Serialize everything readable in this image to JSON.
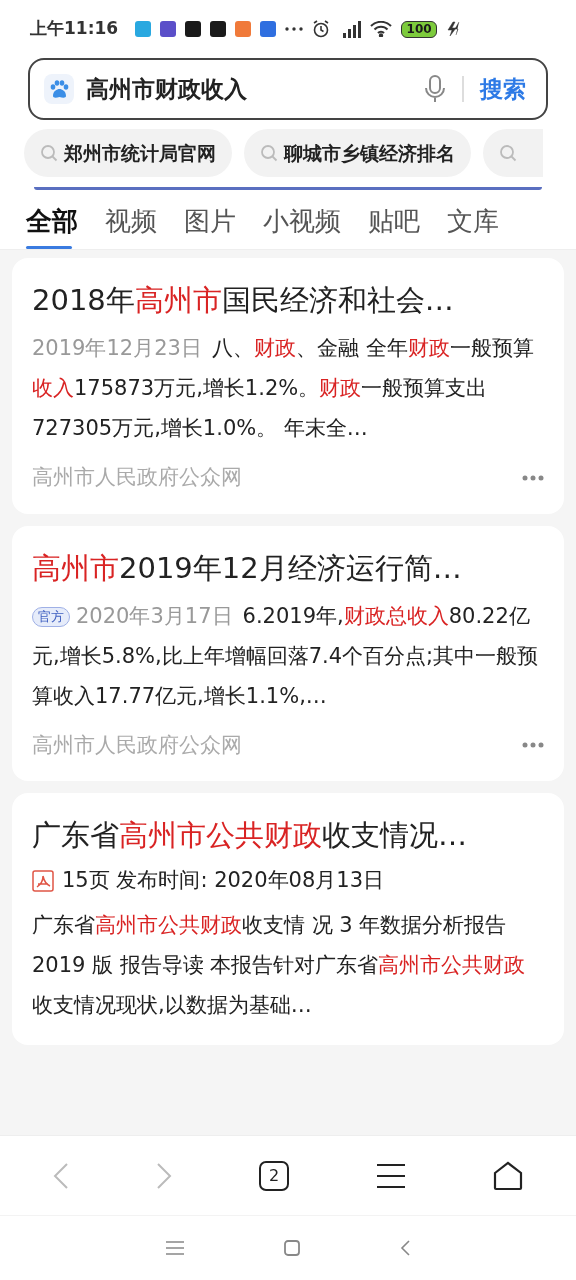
{
  "status_bar": {
    "time": "上午11:16",
    "battery": "100",
    "app_icons": [
      {
        "color": "#29a8e0"
      },
      {
        "color": "#5b4fc9"
      },
      {
        "color": "#1a1a1a"
      },
      {
        "color": "#1a1a1a"
      },
      {
        "color": "#f07a3a"
      },
      {
        "color": "#2f6fe0"
      }
    ]
  },
  "search": {
    "query": "高州市财政收入",
    "button": "搜索"
  },
  "suggestions": [
    "郑州市统计局官网",
    "聊城市乡镇经济排名"
  ],
  "tabs": [
    {
      "label": "全部",
      "selected": true
    },
    {
      "label": "视频",
      "selected": false
    },
    {
      "label": "图片",
      "selected": false
    },
    {
      "label": "小视频",
      "selected": false
    },
    {
      "label": "贴吧",
      "selected": false
    },
    {
      "label": "文库",
      "selected": false
    }
  ],
  "results": [
    {
      "kind": "web",
      "title": [
        {
          "text": "2018年",
          "highlight": false
        },
        {
          "text": "高州市",
          "highlight": true
        },
        {
          "text": "国民经济和社会…",
          "highlight": false
        }
      ],
      "meta": "2019年12月23日",
      "snippet": [
        {
          "text": "八、",
          "highlight": false
        },
        {
          "text": "财政",
          "highlight": true
        },
        {
          "text": "、金融 全年",
          "highlight": false
        },
        {
          "text": "财政",
          "highlight": true
        },
        {
          "text": "一般预算",
          "highlight": false
        },
        {
          "text": "收入",
          "highlight": true
        },
        {
          "text": "175873万元,增长1.2%。",
          "highlight": false
        },
        {
          "text": "财政",
          "highlight": true
        },
        {
          "text": "一般预算支出727305万元,增长1.0%。 年末全…",
          "highlight": false
        }
      ],
      "source": "高州市人民政府公众网"
    },
    {
      "kind": "web",
      "title": [
        {
          "text": "高州市",
          "highlight": true
        },
        {
          "text": "2019年12月经济运行简…",
          "highlight": false
        }
      ],
      "badge": "官方",
      "meta": "2020年3月17日",
      "snippet": [
        {
          "text": "6.2019年,",
          "highlight": false
        },
        {
          "text": "财政总收入",
          "highlight": true
        },
        {
          "text": "80.22亿元,增长5.8%,比上年增幅回落7.4个百分点;其中一般预算收入17.77亿元,增长1.1%,…",
          "highlight": false
        }
      ],
      "source": "高州市人民政府公众网"
    },
    {
      "kind": "doc",
      "title": [
        {
          "text": "广东省",
          "highlight": false
        },
        {
          "text": "高州市公共财政",
          "highlight": true
        },
        {
          "text": "收支情况…",
          "highlight": false
        }
      ],
      "meta": "15页  发布时间: 2020年08月13日",
      "snippet": [
        {
          "text": "广东省",
          "highlight": false
        },
        {
          "text": "高州市公共财政",
          "highlight": true
        },
        {
          "text": "收支情 况 3 年数据分析报告 2019 版 报告导读 本报告针对广东省",
          "highlight": false
        },
        {
          "text": "高州市公共财政",
          "highlight": true
        },
        {
          "text": "收支情况现状,以数据为基础…",
          "highlight": false
        }
      ]
    }
  ],
  "bottom_bar": {
    "tab_count": "2"
  }
}
